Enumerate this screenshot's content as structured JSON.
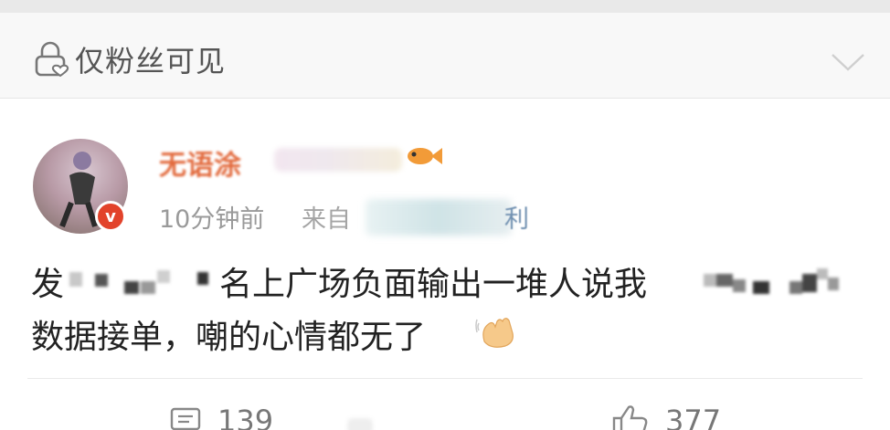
{
  "visibility": {
    "label": "仅粉丝可见",
    "lock_icon": "lock-icon",
    "expand_icon": "chevron-down-icon"
  },
  "post": {
    "username_visible": "无语涂",
    "verified_badge": "v",
    "time": "10分钟前",
    "from_label": "来自",
    "source_tail": "利",
    "line1_prefix": "发",
    "line1_mid": "名上广场负面输出一堆人说我",
    "line2": "数据接单，嘲的心情都无了",
    "emoji": "waving-hand-icon"
  },
  "actions": {
    "comment_count": "139",
    "like_count": "377"
  },
  "colors": {
    "verified": "#e2432b",
    "username": "#e26a3d",
    "meta": "#9a9a9a"
  }
}
